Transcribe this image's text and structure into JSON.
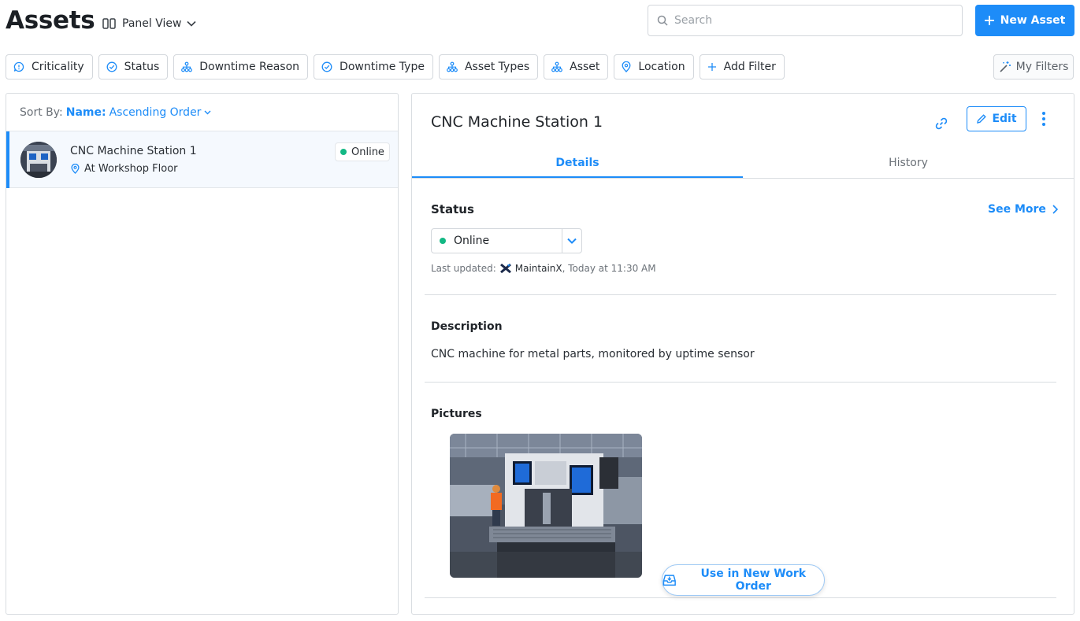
{
  "header": {
    "title": "Assets",
    "view_label": "Panel View",
    "search_placeholder": "Search",
    "new_asset_label": "New Asset"
  },
  "filters": [
    {
      "label": "Criticality",
      "icon": "criticality-icon"
    },
    {
      "label": "Status",
      "icon": "status-check-icon"
    },
    {
      "label": "Downtime Reason",
      "icon": "hierarchy-icon"
    },
    {
      "label": "Downtime Type",
      "icon": "status-check-icon"
    },
    {
      "label": "Asset Types",
      "icon": "hierarchy-icon"
    },
    {
      "label": "Asset",
      "icon": "hierarchy-icon"
    },
    {
      "label": "Location",
      "icon": "location-pin-icon"
    },
    {
      "label": "Add Filter",
      "icon": "plus-icon"
    }
  ],
  "my_filters_label": "My Filters",
  "list": {
    "sort_prefix": "Sort By:",
    "sort_field": "Name:",
    "sort_order": "Ascending Order",
    "items": [
      {
        "title": "CNC Machine Station 1",
        "location": "At Workshop Floor",
        "status": "Online"
      }
    ]
  },
  "detail": {
    "title": "CNC Machine Station 1",
    "edit_label": "Edit",
    "tabs": [
      "Details",
      "History"
    ],
    "status_heading": "Status",
    "see_more": "See More",
    "status_value": "Online",
    "last_updated_label": "Last updated:",
    "last_updated_by": "MaintainX",
    "last_updated_time": ", Today at 11:30 AM",
    "description_heading": "Description",
    "description": "CNC machine for metal parts, monitored by uptime sensor",
    "pictures_heading": "Pictures",
    "use_in_wo": "Use in New Work Order"
  },
  "colors": {
    "accent": "#1d8cf8",
    "online": "#13b884"
  }
}
